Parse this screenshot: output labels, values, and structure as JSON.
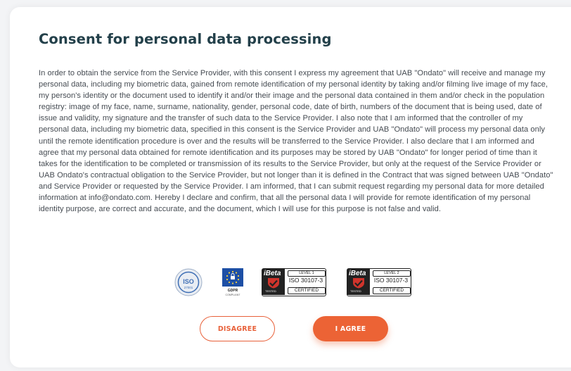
{
  "dialog": {
    "title": "Consent for personal data processing",
    "consent_text": "In order to obtain the service from the Service Provider, with this consent I express my agreement that UAB \"Ondato\" will receive and manage my personal data, including my biometric data, gained from remote identification of my personal identity by taking and/or filming live image of my face, my person's identity or the document used to identify it and/or their image and the personal data contained in them and/or check in the population registry: image of my face, name, surname, nationality, gender, personal code, date of birth, numbers of the document that is being used, date of issue and validity, my signature and the transfer of such data to the Service Provider. I also note that I am informed that the controller of my personal data, including my biometric data, specified in this consent is the Service Provider and UAB \"Ondato\" will process my personal data only until the remote identification procedure is over and the results will be transferred to the Service Provider. I also declare that I am informed and agree that my personal data obtained for remote identification and its purposes may be stored by UAB \"Ondato\" for longer period of time than it takes for the identification to be completed or transmission of its results to the Service Provider, but only at the request of the Service Provider or UAB Ondato's contractual obligation to the Service Provider, but not longer than it is defined in the Contract that was signed between UAB \"Ondato\" and Service Provider or requested by the Service Provider. I am informed, that I can submit request regarding my personal data for more detailed information at info@ondato.com. Hereby I declare and confirm, that all the personal data I will provide for remote identification of my personal identity purpose, are correct and accurate, and the document, which I will use for this purpose is not false and valid."
  },
  "badges": {
    "iso": {
      "icon": "iso-27001-badge-icon",
      "label": "ISO",
      "number": "27001"
    },
    "gdpr": {
      "icon": "gdpr-compliant-badge-icon",
      "label": "GDPR",
      "sublabel": "COMPLIANT"
    },
    "ibeta_level1": {
      "brand": "iBeta",
      "tested": "TESTED",
      "level": "LEVEL 1",
      "standard": "ISO 30107-3",
      "status": "CERTIFIED"
    },
    "ibeta_level2": {
      "brand": "iBeta",
      "tested": "TESTED",
      "level": "LEVEL 2",
      "standard": "ISO 30107-3",
      "status": "CERTIFIED"
    }
  },
  "actions": {
    "disagree_label": "DISAGREE",
    "agree_label": "I AGREE"
  },
  "colors": {
    "title": "#23404a",
    "body_text": "#454b52",
    "accent": "#ec6335",
    "gdpr_blue": "#1d4fa5",
    "iso_blue": "#3f6fb5"
  }
}
